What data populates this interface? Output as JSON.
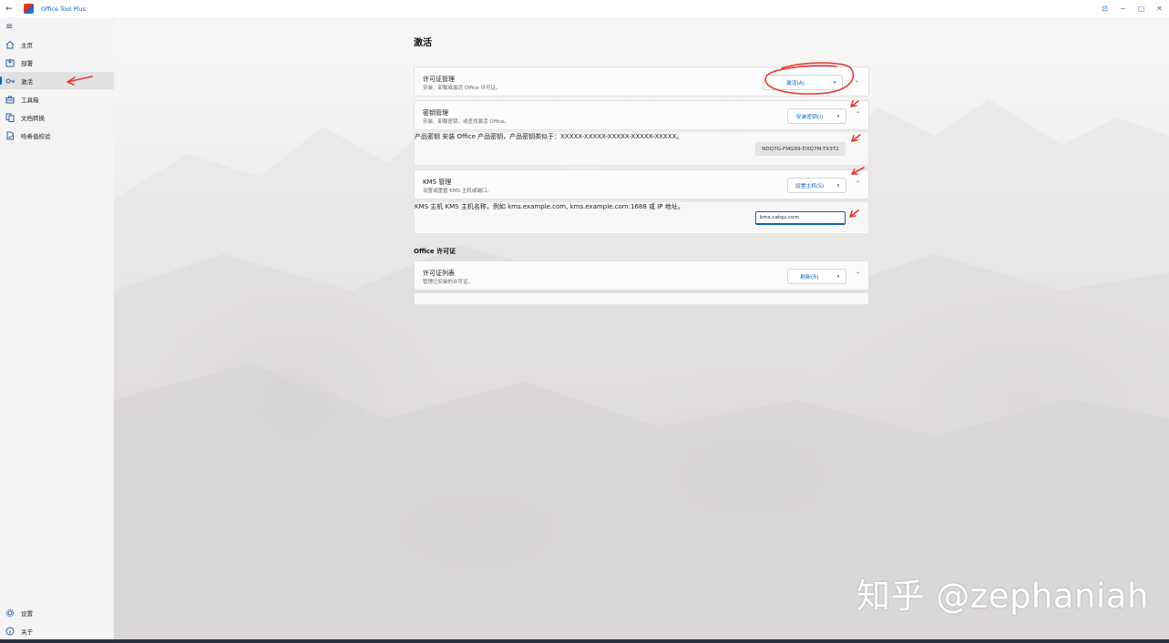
{
  "window": {
    "title": "Office Tool Plus",
    "controls": [
      "⊡",
      "−",
      "▢",
      "✕"
    ]
  },
  "sidebar": {
    "items": [
      {
        "label": "主页",
        "icon": "home-icon"
      },
      {
        "label": "部署",
        "icon": "deploy-icon"
      },
      {
        "label": "激活",
        "icon": "key-icon",
        "active": true
      },
      {
        "label": "工具箱",
        "icon": "toolbox-icon"
      },
      {
        "label": "文档转换",
        "icon": "document-convert-icon"
      },
      {
        "label": "哈希值校验",
        "icon": "hash-check-icon"
      }
    ],
    "footer": [
      {
        "label": "设置",
        "icon": "gear-icon"
      },
      {
        "label": "关于",
        "icon": "info-icon"
      }
    ]
  },
  "main": {
    "page_title": "激活",
    "license_mgmt": {
      "title": "许可证管理",
      "desc": "安装、卸载或激活 Office 许可证。",
      "button": "激活(A)"
    },
    "key_mgmt": {
      "title": "密钥管理",
      "desc": "安装、卸载密钥，或查找激活 Office。",
      "button": "安装密钥(I)"
    },
    "product_key": {
      "title": "产品密钥",
      "desc": "安装 Office 产品密钥，产品密钥类似于：XXXXX-XXXXX-XXXXX-XXXXX-XXXXX。",
      "value": "NDQ7G-FMG99-DXQ7M-TX3T2"
    },
    "kms_mgmt": {
      "title": "KMS 管理",
      "desc": "设置或重置 KMS 主机或端口。",
      "button": "设置主机(S)"
    },
    "kms_host": {
      "title": "KMS 主机",
      "desc": "KMS 主机名称，例如 kms.example.com, kms.example.com:1688 或 IP 地址。",
      "value": "kms.catqu.com"
    },
    "office_license_section": "Office 许可证",
    "license_list": {
      "title": "许可证列表",
      "desc": "管理已安装的许可证。",
      "button": "刷新(R)"
    }
  },
  "watermark": "知乎 @zephaniah",
  "colors": {
    "accent": "#0a63b8",
    "annotation": "#e53935"
  }
}
